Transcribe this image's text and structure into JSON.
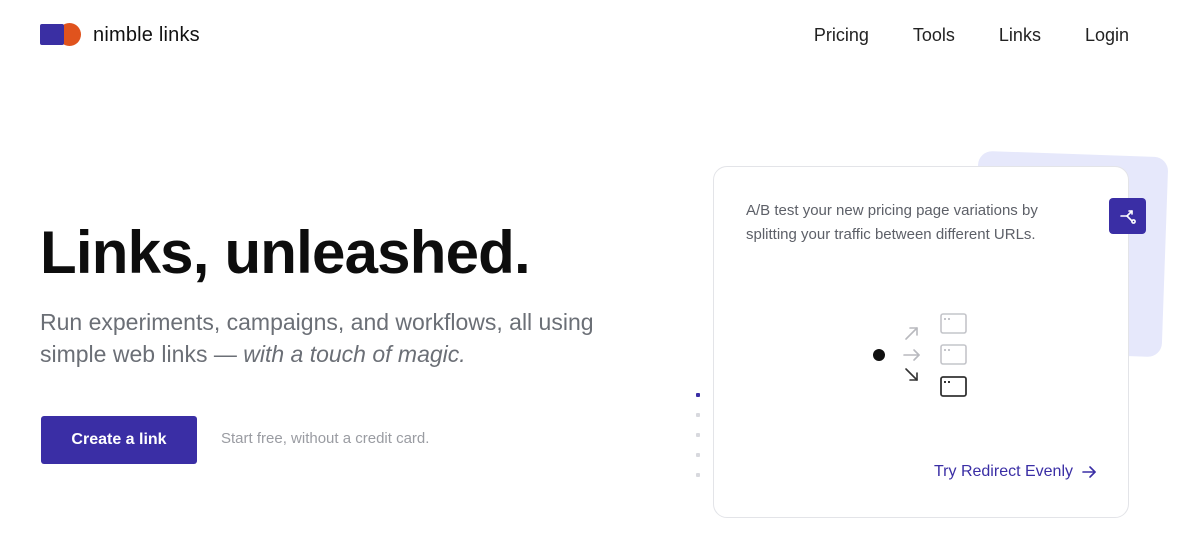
{
  "brand": {
    "name": "nimble links",
    "primary_color": "#3a2ea5",
    "accent_color": "#e0531d"
  },
  "nav": {
    "items": [
      {
        "label": "Pricing"
      },
      {
        "label": "Tools"
      },
      {
        "label": "Links"
      },
      {
        "label": "Login"
      }
    ]
  },
  "hero": {
    "title": "Links, unleashed.",
    "subtitle_plain": "Run experiments, campaigns, and workflows, all using simple web links —",
    "subtitle_em": "with a touch of magic.",
    "cta_label": "Create a link",
    "cta_note": "Start free, without a credit card."
  },
  "feature_card": {
    "description": "A/B test your new pricing page variations by splitting your traffic between different URLs.",
    "icon": "split-icon",
    "link_label": "Try Redirect Evenly",
    "link_icon": "arrow-right-icon"
  },
  "carousel": {
    "total": 5,
    "active_index": 0
  }
}
